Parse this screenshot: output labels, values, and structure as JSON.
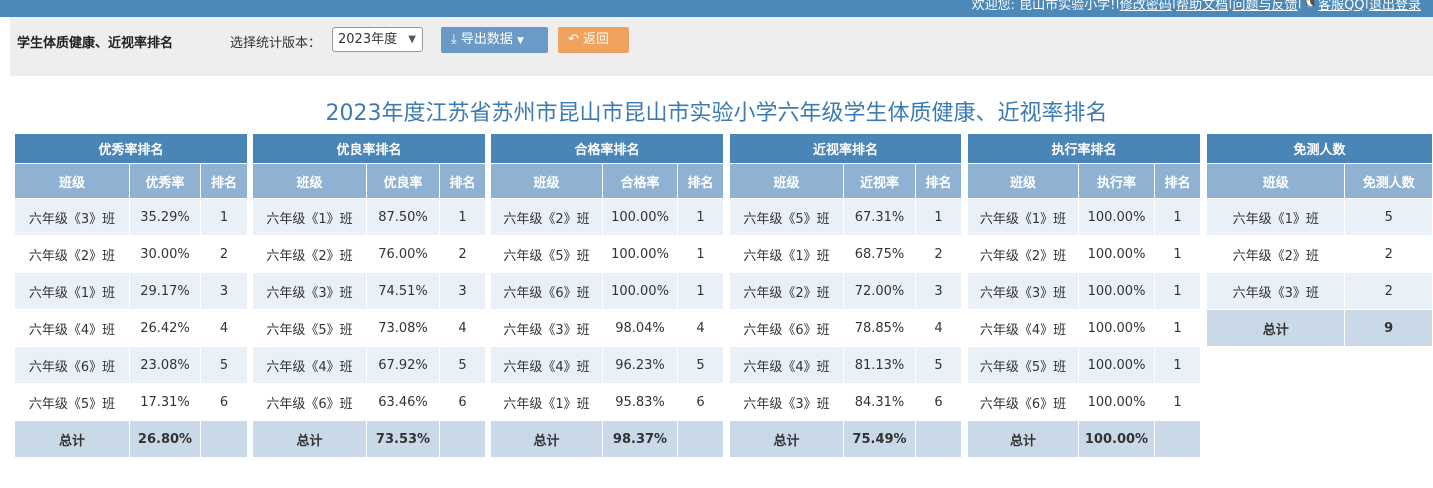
{
  "topbar": {
    "welcome": "欢迎您: 昆山市实验小学!",
    "sep": "|",
    "change_password": "修改密码",
    "help": "帮助文档",
    "feedback": "问题与反馈",
    "qq": "客服QQ",
    "logout": "退出登录"
  },
  "toolbar": {
    "title": "学生体质健康、近视率排名",
    "version_label": "选择统计版本：",
    "version_value": "2023年度",
    "export_label": "导出数据",
    "back_label": "返回"
  },
  "main_title": "2023年度江苏省苏州市昆山市昆山市实验小学六年级学生体质健康、近视率排名",
  "tables": [
    {
      "group": "优秀率排名",
      "headers": [
        "班级",
        "优秀率",
        "排名"
      ],
      "rows": [
        [
          "六年级《3》班",
          "35.29%",
          "1"
        ],
        [
          "六年级《2》班",
          "30.00%",
          "2"
        ],
        [
          "六年级《1》班",
          "29.17%",
          "3"
        ],
        [
          "六年级《4》班",
          "26.42%",
          "4"
        ],
        [
          "六年级《6》班",
          "23.08%",
          "5"
        ],
        [
          "六年级《5》班",
          "17.31%",
          "6"
        ]
      ],
      "total": [
        "总计",
        "26.80%",
        ""
      ]
    },
    {
      "group": "优良率排名",
      "headers": [
        "班级",
        "优良率",
        "排名"
      ],
      "rows": [
        [
          "六年级《1》班",
          "87.50%",
          "1"
        ],
        [
          "六年级《2》班",
          "76.00%",
          "2"
        ],
        [
          "六年级《3》班",
          "74.51%",
          "3"
        ],
        [
          "六年级《5》班",
          "73.08%",
          "4"
        ],
        [
          "六年级《4》班",
          "67.92%",
          "5"
        ],
        [
          "六年级《6》班",
          "63.46%",
          "6"
        ]
      ],
      "total": [
        "总计",
        "73.53%",
        ""
      ]
    },
    {
      "group": "合格率排名",
      "headers": [
        "班级",
        "合格率",
        "排名"
      ],
      "rows": [
        [
          "六年级《2》班",
          "100.00%",
          "1"
        ],
        [
          "六年级《5》班",
          "100.00%",
          "1"
        ],
        [
          "六年级《6》班",
          "100.00%",
          "1"
        ],
        [
          "六年级《3》班",
          "98.04%",
          "4"
        ],
        [
          "六年级《4》班",
          "96.23%",
          "5"
        ],
        [
          "六年级《1》班",
          "95.83%",
          "6"
        ]
      ],
      "total": [
        "总计",
        "98.37%",
        ""
      ]
    },
    {
      "group": "近视率排名",
      "headers": [
        "班级",
        "近视率",
        "排名"
      ],
      "rows": [
        [
          "六年级《5》班",
          "67.31%",
          "1"
        ],
        [
          "六年级《1》班",
          "68.75%",
          "2"
        ],
        [
          "六年级《2》班",
          "72.00%",
          "3"
        ],
        [
          "六年级《6》班",
          "78.85%",
          "4"
        ],
        [
          "六年级《4》班",
          "81.13%",
          "5"
        ],
        [
          "六年级《3》班",
          "84.31%",
          "6"
        ]
      ],
      "total": [
        "总计",
        "75.49%",
        ""
      ]
    },
    {
      "group": "执行率排名",
      "headers": [
        "班级",
        "执行率",
        "排名"
      ],
      "rows": [
        [
          "六年级《1》班",
          "100.00%",
          "1"
        ],
        [
          "六年级《2》班",
          "100.00%",
          "1"
        ],
        [
          "六年级《3》班",
          "100.00%",
          "1"
        ],
        [
          "六年级《4》班",
          "100.00%",
          "1"
        ],
        [
          "六年级《5》班",
          "100.00%",
          "1"
        ],
        [
          "六年级《6》班",
          "100.00%",
          "1"
        ]
      ],
      "total": [
        "总计",
        "100.00%",
        ""
      ]
    }
  ],
  "exempt": {
    "group": "免测人数",
    "headers": [
      "班级",
      "免测人数"
    ],
    "rows": [
      [
        "六年级《1》班",
        "5"
      ],
      [
        "六年级《2》班",
        "2"
      ],
      [
        "六年级《3》班",
        "2"
      ]
    ],
    "total": [
      "总计",
      "9"
    ]
  }
}
